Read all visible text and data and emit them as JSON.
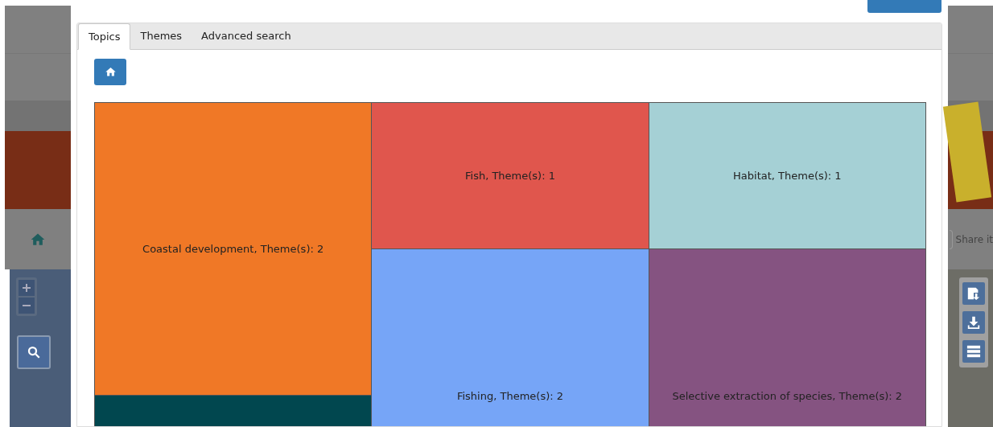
{
  "background": {
    "share_label": "Share it"
  },
  "tabs": [
    {
      "label": "Topics",
      "selected": true
    },
    {
      "label": "Themes",
      "selected": false
    },
    {
      "label": "Advanced search",
      "selected": false
    }
  ],
  "treemap": {
    "columns": [
      {
        "cells": [
          {
            "label": "Coastal development, Theme(s): 2",
            "color": "#f07826"
          },
          {
            "color": "#01474f"
          }
        ]
      },
      {
        "cells": [
          {
            "label": "Fish, Theme(s): 1",
            "color": "#e0564d"
          },
          {
            "label": "Fishing, Theme(s): 2",
            "color": "#76a5f7"
          }
        ]
      },
      {
        "cells": [
          {
            "label": "Habitat, Theme(s): 1",
            "color": "#a5d0d5"
          },
          {
            "label": "Selective extraction of species, Theme(s): 2",
            "color": "#855381"
          }
        ]
      }
    ]
  }
}
